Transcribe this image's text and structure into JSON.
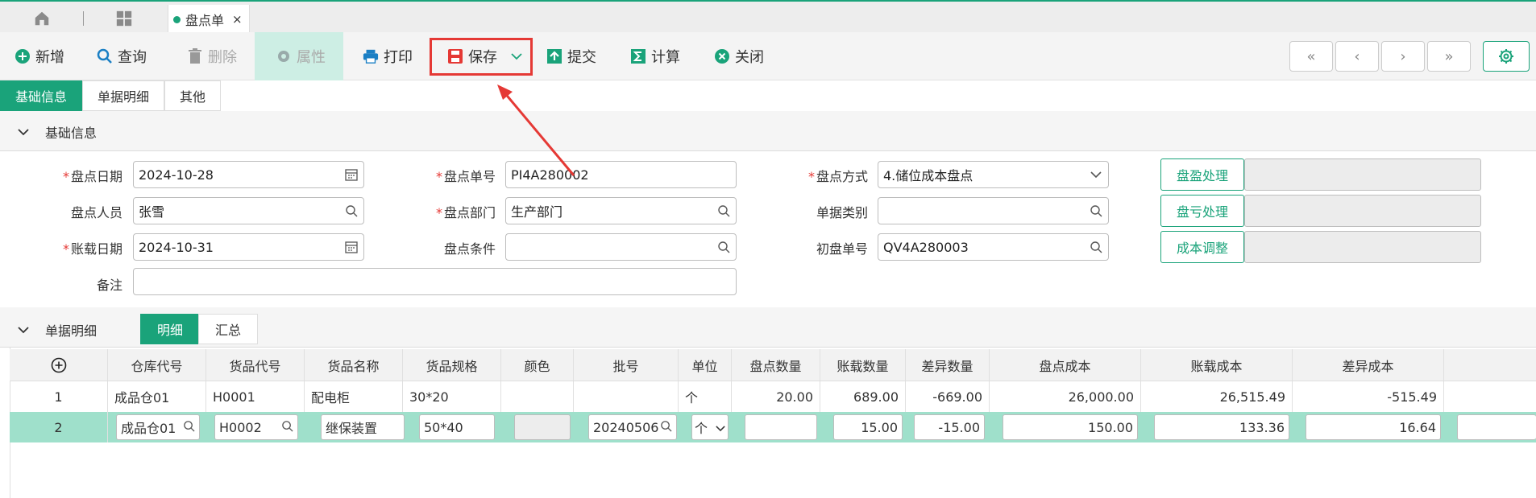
{
  "tabs": {
    "active_label": "盘点单",
    "close": "×"
  },
  "toolbar": {
    "new": "新增",
    "query": "查询",
    "delete": "删除",
    "props": "属性",
    "print": "打印",
    "save": "保存",
    "submit": "提交",
    "calc": "计算",
    "close": "关闭",
    "nav_first": "«",
    "nav_prev": "‹",
    "nav_next": "›",
    "nav_last": "»"
  },
  "subtabs": [
    "基础信息",
    "单据明细",
    "其他"
  ],
  "basic_section": {
    "title": "基础信息"
  },
  "form": {
    "date_label": "盘点日期",
    "date_value": "2024-10-28",
    "no_label": "盘点单号",
    "no_value": "PI4A280002",
    "method_label": "盘点方式",
    "method_value": "4.储位成本盘点",
    "person_label": "盘点人员",
    "person_value": "张雪",
    "dept_label": "盘点部门",
    "dept_value": "生产部门",
    "category_label": "单据类别",
    "category_value": "",
    "account_label": "账载日期",
    "account_value": "2024-10-31",
    "cond_label": "盘点条件",
    "cond_value": "",
    "first_label": "初盘单号",
    "first_value": "QV4A280003",
    "remark_label": "备注",
    "remark_value": "",
    "btn_profit": "盘盈处理",
    "btn_loss": "盘亏处理",
    "btn_cost": "成本调整"
  },
  "detail_section": {
    "title": "单据明细",
    "seg_detail": "明细",
    "seg_summary": "汇总"
  },
  "table": {
    "columns": [
      "仓库代号",
      "货品代号",
      "货品名称",
      "货品规格",
      "颜色",
      "批号",
      "单位",
      "盘点数量",
      "账载数量",
      "差异数量",
      "盘点成本",
      "账载成本",
      "差异成本"
    ],
    "rows": [
      {
        "no": "1",
        "wh": "成品仓01",
        "code": "H0001",
        "name": "配电柜",
        "spec": "30*20",
        "color": "",
        "batch": "",
        "unit": "个",
        "count": "20.00",
        "book": "689.00",
        "diff": "-669.00",
        "cost": "26,000.00",
        "bookcost": "26,515.49",
        "diffcost": "-515.49"
      },
      {
        "no": "2",
        "wh": "成品仓01",
        "code": "H0002",
        "name": "继保装置",
        "spec": "50*40",
        "color": "",
        "batch": "20240506",
        "unit": "个",
        "count": "",
        "book": "15.00",
        "diff": "-15.00",
        "cost": "150.00",
        "bookcost": "133.36",
        "diffcost": "16.64"
      }
    ]
  },
  "colors": {
    "accent": "#1aa37a",
    "highlight": "#e53935",
    "selected_row": "#9fe0cb"
  }
}
